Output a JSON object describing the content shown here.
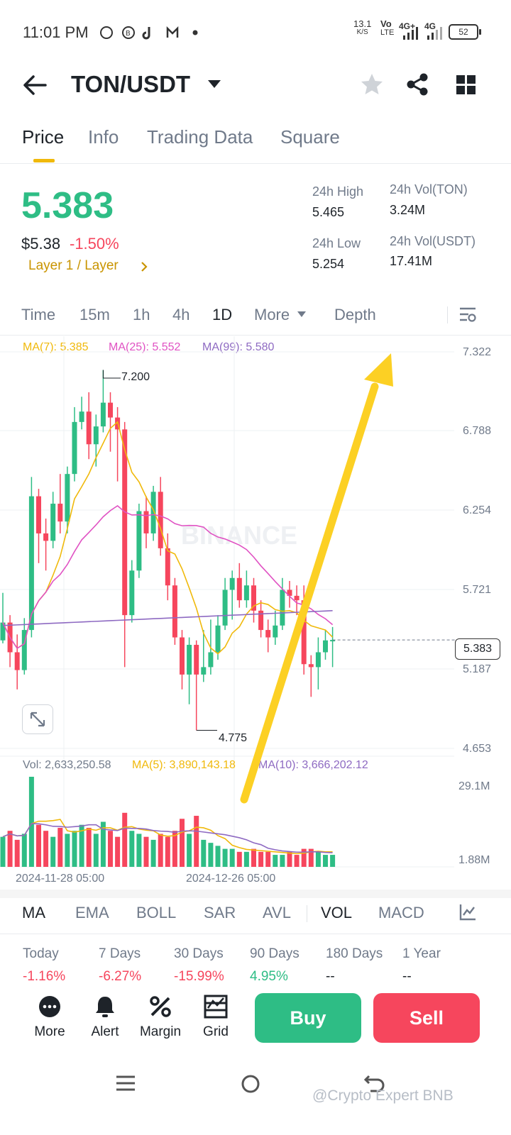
{
  "status_bar": {
    "time": "11:01 PM",
    "left_icons": [
      "whatsapp-icon",
      "bitcoin-icon",
      "tiktok-icon",
      "gmail-icon",
      "dot-icon"
    ],
    "speed_value": "13.1",
    "speed_unit": "K/S",
    "volte_top": "Vo",
    "volte_bottom": "LTE",
    "net1": "4G+",
    "net2": "4G",
    "battery": "52"
  },
  "header": {
    "pair": "TON/USDT",
    "icons": [
      "back-arrow-icon",
      "caret-down-icon",
      "star-icon",
      "share-icon",
      "grid-icon"
    ]
  },
  "tabs": [
    {
      "label": "Price",
      "active": true
    },
    {
      "label": "Info",
      "active": false
    },
    {
      "label": "Trading Data",
      "active": false
    },
    {
      "label": "Square",
      "active": false
    }
  ],
  "ticker": {
    "last_price": "5.383",
    "usd_price": "$5.38",
    "change_pct": "-1.50%",
    "category": "Layer 1 / Layer",
    "high_label": "24h High",
    "high_value": "5.465",
    "low_label": "24h Low",
    "low_value": "5.254",
    "vol_ton_label": "24h Vol(TON)",
    "vol_ton_value": "3.24M",
    "vol_usdt_label": "24h Vol(USDT)",
    "vol_usdt_value": "17.41M"
  },
  "intervals": {
    "items": [
      "Time",
      "15m",
      "1h",
      "4h",
      "1D",
      "More",
      "Depth"
    ],
    "selected": "1D"
  },
  "ma_legend": {
    "ma7": "MA(7): 5.385",
    "ma25": "MA(25): 5.552",
    "ma99": "MA(99): 5.580"
  },
  "vol_legend": {
    "vol": "Vol: 2,633,250.58",
    "ma5": "MA(5): 3,890,143.18",
    "ma10": "MA(10): 3,666,202.12"
  },
  "dates": [
    "2024-11-28 05:00",
    "2024-12-26 05:00"
  ],
  "chart_data": {
    "type": "candlestick",
    "price_axis": [
      "7.322",
      "6.788",
      "6.254",
      "5.721",
      "5.187",
      "4.653"
    ],
    "volume_axis": [
      "29.1M",
      "1.88M"
    ],
    "high_marker": "7.200",
    "low_marker": "4.775",
    "current_price_tag": "5.383",
    "colors": {
      "up": "#2ebd85",
      "down": "#f6465d",
      "ma7": "#f0b90b",
      "ma25": "#e052c3",
      "ma99": "#8e6ac2"
    },
    "candles": [
      [
        5.38,
        5.5,
        5.7,
        5.36
      ],
      [
        5.5,
        5.3,
        5.55,
        5.2
      ],
      [
        5.3,
        5.18,
        5.42,
        5.05
      ],
      [
        5.18,
        5.45,
        5.53,
        5.15
      ],
      [
        5.45,
        6.35,
        6.48,
        5.4
      ],
      [
        6.35,
        6.1,
        6.4,
        5.9
      ],
      [
        6.1,
        6.05,
        6.2,
        5.85
      ],
      [
        6.05,
        6.3,
        6.38,
        6.0
      ],
      [
        6.3,
        6.18,
        6.5,
        6.1
      ],
      [
        6.18,
        6.5,
        6.55,
        6.1
      ],
      [
        6.5,
        6.85,
        6.95,
        6.45
      ],
      [
        6.85,
        6.92,
        7.02,
        6.8
      ],
      [
        6.92,
        6.7,
        7.05,
        6.6
      ],
      [
        6.7,
        6.82,
        6.9,
        6.55
      ],
      [
        6.82,
        6.98,
        7.2,
        6.78
      ],
      [
        6.98,
        6.88,
        7.05,
        6.65
      ],
      [
        6.88,
        6.8,
        6.95,
        6.45
      ],
      [
        6.8,
        5.55,
        6.85,
        5.2
      ],
      [
        5.55,
        5.85,
        5.92,
        5.5
      ],
      [
        5.85,
        6.25,
        6.3,
        5.8
      ],
      [
        6.25,
        6.1,
        6.35,
        6.0
      ],
      [
        6.1,
        6.38,
        6.42,
        6.05
      ],
      [
        6.38,
        6.0,
        6.48,
        5.95
      ],
      [
        6.0,
        5.75,
        6.1,
        5.65
      ],
      [
        5.75,
        5.4,
        5.8,
        5.35
      ],
      [
        5.4,
        5.15,
        5.45,
        5.05
      ],
      [
        5.15,
        5.35,
        5.4,
        4.95
      ],
      [
        5.35,
        5.15,
        5.38,
        4.775
      ],
      [
        5.15,
        5.2,
        5.45,
        5.1
      ],
      [
        5.2,
        5.3,
        5.52,
        5.15
      ],
      [
        5.3,
        5.48,
        5.55,
        5.25
      ],
      [
        5.48,
        5.72,
        5.8,
        5.45
      ],
      [
        5.72,
        5.8,
        5.85,
        5.52
      ],
      [
        5.8,
        5.65,
        5.9,
        5.6
      ],
      [
        5.65,
        5.75,
        5.85,
        5.6
      ],
      [
        5.75,
        5.58,
        5.8,
        5.5
      ],
      [
        5.58,
        5.45,
        5.65,
        5.4
      ],
      [
        5.45,
        5.4,
        5.52,
        5.3
      ],
      [
        5.4,
        5.48,
        5.58,
        5.35
      ],
      [
        5.48,
        5.72,
        5.8,
        5.45
      ],
      [
        5.72,
        5.68,
        5.78,
        5.6
      ],
      [
        5.68,
        5.65,
        5.75,
        5.55
      ],
      [
        5.65,
        5.22,
        5.75,
        5.15
      ],
      [
        5.22,
        5.2,
        5.28,
        5.0
      ],
      [
        5.2,
        5.3,
        5.4,
        5.05
      ],
      [
        5.3,
        5.38,
        5.45,
        5.25
      ],
      [
        5.38,
        5.383,
        5.47,
        5.2
      ]
    ],
    "volumes": [
      10,
      12,
      9,
      11,
      30,
      14,
      12,
      10,
      13,
      11,
      12,
      14,
      13,
      11,
      15,
      12,
      10,
      18,
      12,
      11,
      10,
      9,
      11,
      10,
      12,
      16,
      11,
      17,
      9,
      8,
      7,
      6,
      6,
      5,
      5,
      6,
      5,
      5,
      4,
      4,
      5,
      4,
      6,
      6,
      5,
      4,
      4
    ]
  },
  "indicators": {
    "items": [
      "MA",
      "EMA",
      "BOLL",
      "SAR",
      "AVL",
      "VOL",
      "MACD"
    ],
    "active": [
      "MA",
      "VOL"
    ]
  },
  "performance": [
    {
      "label": "Today",
      "value": "-1.16%",
      "color": "#f6465d"
    },
    {
      "label": "7 Days",
      "value": "-6.27%",
      "color": "#f6465d"
    },
    {
      "label": "30 Days",
      "value": "-15.99%",
      "color": "#f6465d"
    },
    {
      "label": "90 Days",
      "value": "4.95%",
      "color": "#2ebd85"
    },
    {
      "label": "180 Days",
      "value": "--",
      "color": "#1e2329"
    },
    {
      "label": "1 Year",
      "value": "--",
      "color": "#1e2329"
    }
  ],
  "bottom_bar": {
    "more": "More",
    "alert": "Alert",
    "margin": "Margin",
    "grid": "Grid",
    "buy": "Buy",
    "sell": "Sell",
    "buy_color": "#2ebd85",
    "sell_color": "#f6465d"
  },
  "watermark": "@Crypto Expert BNB",
  "chart_watermark": "BINANCE"
}
